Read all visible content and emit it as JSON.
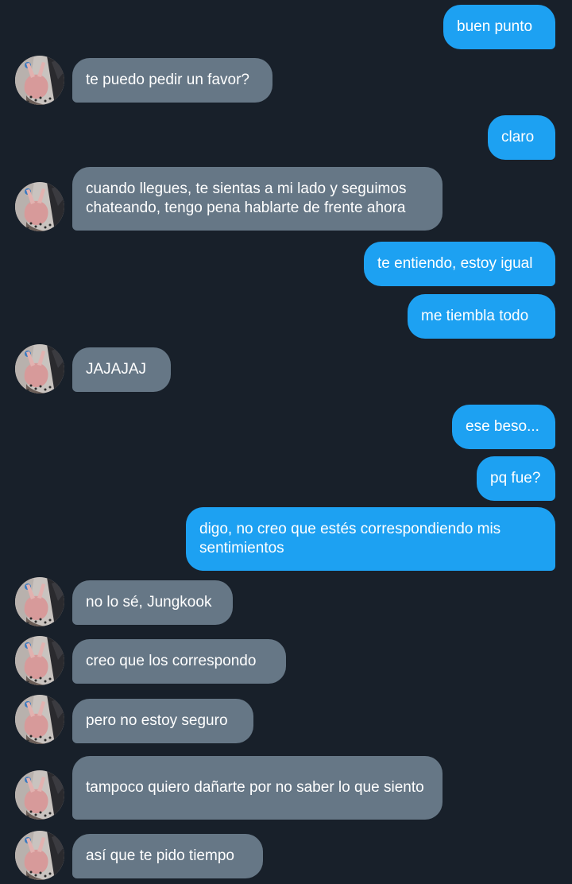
{
  "colors": {
    "background": "#18202a",
    "outgoing_bubble": "#1da1f2",
    "incoming_bubble": "#667786",
    "text": "#ffffff"
  },
  "contact": {
    "avatar_icon": "contact-avatar-photo"
  },
  "messages": [
    {
      "direction": "outgoing",
      "text": "buen punto"
    },
    {
      "direction": "incoming",
      "text": "te puedo pedir un favor?"
    },
    {
      "direction": "outgoing",
      "text": "claro"
    },
    {
      "direction": "incoming",
      "text": "cuando llegues, te sientas a mi lado y seguimos chateando, tengo pena hablarte de frente ahora"
    },
    {
      "direction": "outgoing",
      "text": "te entiendo, estoy igual"
    },
    {
      "direction": "outgoing",
      "text": "me tiembla todo"
    },
    {
      "direction": "incoming",
      "text": "JAJAJAJ"
    },
    {
      "direction": "outgoing",
      "text": "ese beso..."
    },
    {
      "direction": "outgoing",
      "text": "pq fue?"
    },
    {
      "direction": "outgoing",
      "text": "digo, no creo que estés correspondiendo mis sentimientos"
    },
    {
      "direction": "incoming",
      "text": "no lo sé, Jungkook"
    },
    {
      "direction": "incoming",
      "text": "creo que los correspondo"
    },
    {
      "direction": "incoming",
      "text": "pero no estoy seguro"
    },
    {
      "direction": "incoming",
      "text": "tampoco quiero dañarte por no saber lo que siento"
    },
    {
      "direction": "incoming",
      "text": "así que te pido tiempo"
    }
  ]
}
